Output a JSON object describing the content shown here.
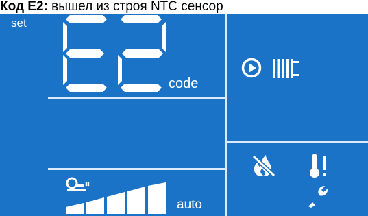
{
  "caption": {
    "code": "Код E2:",
    "message": " вышел из строя NTC сенсор"
  },
  "display": {
    "set_label": "set",
    "error_code": "E2",
    "code_label": "code",
    "auto_label": "auto",
    "power_level": {
      "filled": 5,
      "total": 5
    }
  },
  "icons": {
    "pump": "pump-play-icon",
    "radiator": "radiator-icon",
    "burner_off": "burner-off-icon",
    "temp_alert": "temperature-alert-icon",
    "service": "wrench-icon",
    "hot_water_tap": "tap-icon"
  },
  "colors": {
    "lcd_background": "#1a73c7",
    "segment": "#ffffff",
    "lines": "#dbeaff"
  }
}
